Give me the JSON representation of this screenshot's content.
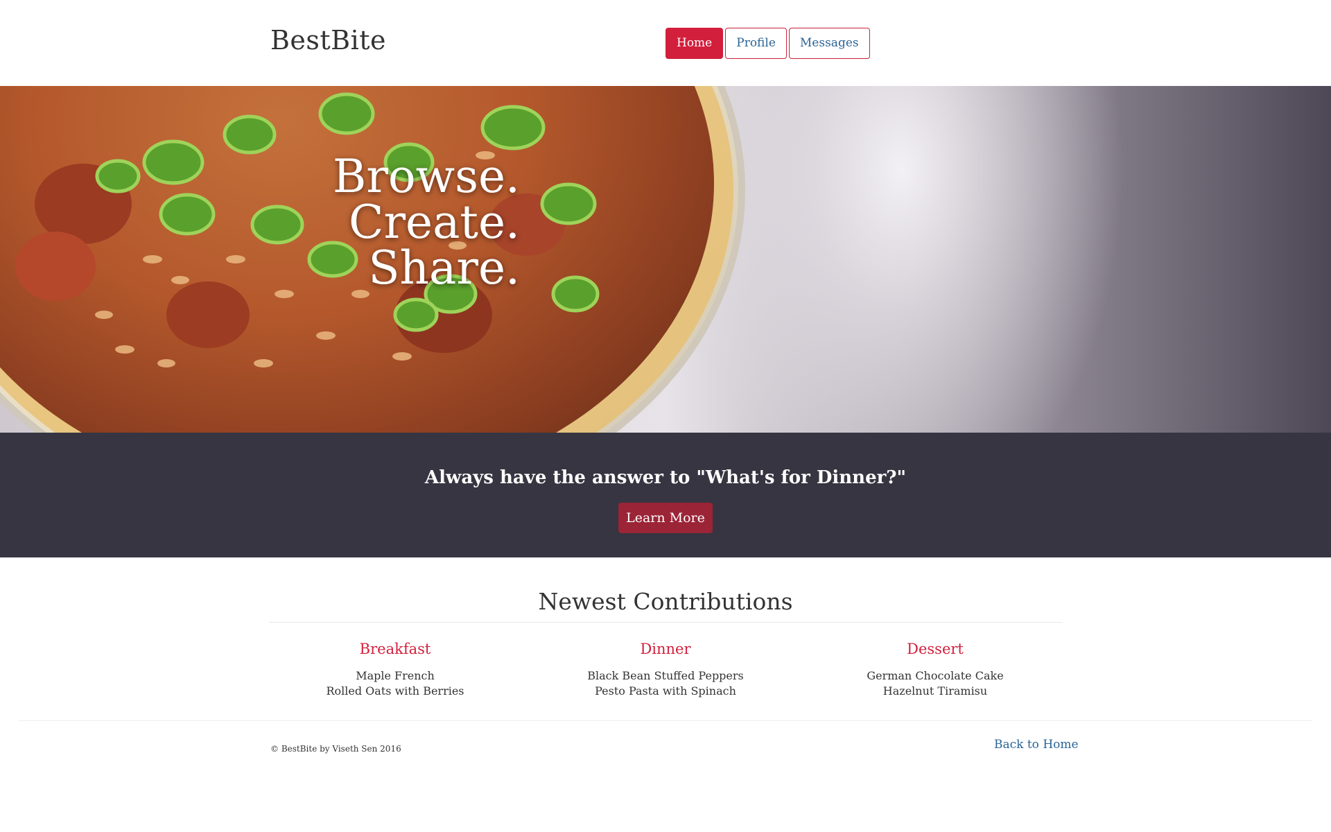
{
  "header": {
    "brand": "BestBite",
    "nav": [
      {
        "label": "Home",
        "active": true
      },
      {
        "label": "Profile",
        "active": false
      },
      {
        "label": "Messages",
        "active": false
      }
    ]
  },
  "hero": {
    "lines": [
      "Browse.",
      "Create.",
      "Share."
    ]
  },
  "band": {
    "title": "Always have the answer to \"What's for Dinner?\"",
    "button_label": "Learn More"
  },
  "contributions": {
    "title": "Newest Contributions",
    "columns": [
      {
        "heading": "Breakfast",
        "items": [
          "Maple French",
          "Rolled Oats with Berries"
        ]
      },
      {
        "heading": "Dinner",
        "items": [
          "Black Bean Stuffed Peppers",
          "Pesto Pasta with Spinach"
        ]
      },
      {
        "heading": "Dessert",
        "items": [
          "German Chocolate Cake",
          "Hazelnut Tiramisu"
        ]
      }
    ]
  },
  "footer": {
    "copyright": "© BestBite by Viseth Sen 2016",
    "back_link": "Back to Home"
  },
  "colors": {
    "accent": "#d21f3c",
    "band": "#363541",
    "learn_button": "#9b2436",
    "link": "#2a6496"
  }
}
